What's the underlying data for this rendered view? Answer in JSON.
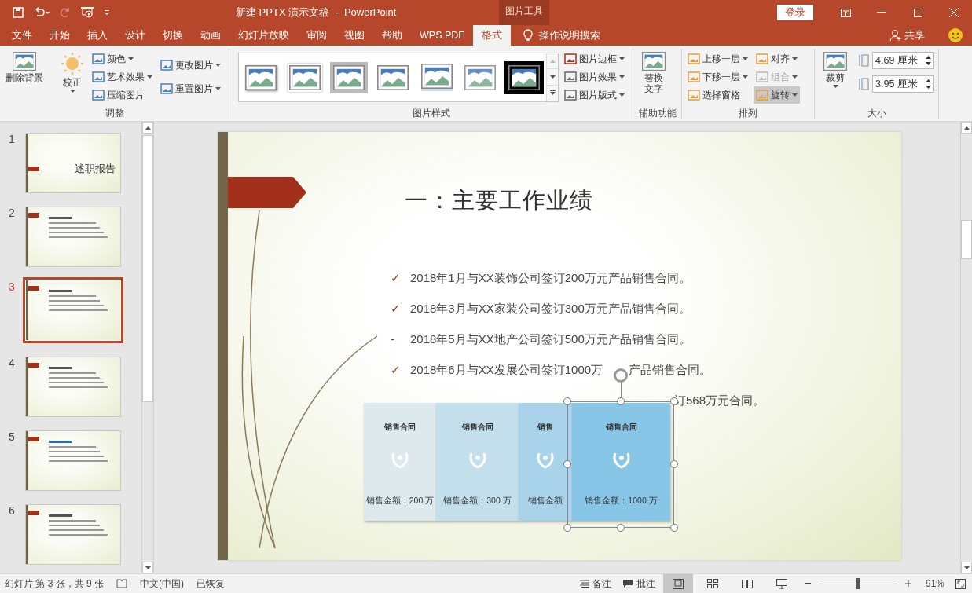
{
  "window": {
    "title": "新建 PPTX 演示文稿  -  PowerPoint",
    "context_tab": "图片工具",
    "login": "登录"
  },
  "tabs": [
    {
      "label": "文件",
      "selected": false
    },
    {
      "label": "开始",
      "selected": false
    },
    {
      "label": "插入",
      "selected": false
    },
    {
      "label": "设计",
      "selected": false
    },
    {
      "label": "切换",
      "selected": false
    },
    {
      "label": "动画",
      "selected": false
    },
    {
      "label": "幻灯片放映",
      "selected": false
    },
    {
      "label": "审阅",
      "selected": false
    },
    {
      "label": "视图",
      "selected": false
    },
    {
      "label": "帮助",
      "selected": false
    },
    {
      "label": "WPS PDF",
      "selected": false
    },
    {
      "label": "格式",
      "selected": true
    }
  ],
  "tell_me": "操作说明搜索",
  "share": "共享",
  "ribbon": {
    "adjust": {
      "label": "调整",
      "remove_bg": "删除背景",
      "corrections": "校正",
      "small": [
        {
          "label": "颜色",
          "caret": true
        },
        {
          "label": "艺术效果",
          "caret": true
        },
        {
          "label": "压缩图片",
          "caret": false
        }
      ],
      "change": [
        {
          "label": "更改图片"
        },
        {
          "label": "重置图片"
        }
      ]
    },
    "styles": {
      "label": "图片样式",
      "gallery": [
        {
          "kind": "shadow"
        },
        {
          "kind": "frame"
        },
        {
          "kind": "gray"
        },
        {
          "kind": "plain"
        },
        {
          "kind": "reflect"
        },
        {
          "kind": "soft"
        },
        {
          "kind": "black"
        }
      ],
      "buttons": [
        {
          "label": "图片边框"
        },
        {
          "label": "图片效果"
        },
        {
          "label": "图片版式"
        }
      ]
    },
    "accessibility": {
      "label": "辅助功能",
      "alt_text": "替换文字"
    },
    "arrange": {
      "label": "排列",
      "items": [
        {
          "label": "上移一层",
          "disabled": false,
          "pressed": false
        },
        {
          "label": "下移一层",
          "disabled": false,
          "pressed": false
        },
        {
          "label": "选择窗格",
          "disabled": false,
          "pressed": false
        }
      ],
      "items2": [
        {
          "label": "对齐",
          "disabled": false,
          "pressed": false
        },
        {
          "label": "组合",
          "disabled": true,
          "pressed": false
        },
        {
          "label": "旋转",
          "disabled": false,
          "pressed": true
        }
      ]
    },
    "size": {
      "label": "大小",
      "crop": "裁剪",
      "height": "4.69 厘米",
      "width": "3.95 厘米"
    }
  },
  "slides": [
    {
      "number": "1",
      "selected": false,
      "title": "述职报告"
    },
    {
      "number": "2",
      "selected": false
    },
    {
      "number": "3",
      "selected": true
    },
    {
      "number": "4",
      "selected": false
    },
    {
      "number": "5",
      "selected": false
    },
    {
      "number": "6",
      "selected": false
    }
  ],
  "slide": {
    "title": "一：主要工作业绩",
    "bullets": [
      {
        "kind": "full",
        "marker": "✓",
        "parts": [
          "2018年1月与XX装饰公司签订200万元产品销售合同。"
        ]
      },
      {
        "kind": "full",
        "marker": "✓",
        "parts": [
          "2018年3月与XX家装公司签订300万元产品销售合同。"
        ]
      },
      {
        "kind": "full",
        "marker": "-",
        "parts": [
          "2018年5月与XX地产公司签订500万元产品销售合同。"
        ]
      },
      {
        "kind": "full",
        "marker": "✓",
        "parts": [
          "2018年6月与XX发展公司签订1000万",
          "产品销售合同。"
        ]
      },
      {
        "kind": "covered",
        "parts": [
          "订568万元合同。"
        ]
      }
    ],
    "cards": [
      {
        "title": "销售合同",
        "amount": "销售金额：200 万",
        "color": "#dde9ed",
        "selected": false
      },
      {
        "title": "销售合同",
        "amount": "销售金额：300 万",
        "color": "#c2dfeb",
        "selected": false
      },
      {
        "title": "销售",
        "amount": "销售金额",
        "color": "#a9d3ea",
        "selected": false
      },
      {
        "title": "销售合同",
        "amount": "销售金额：1000 万",
        "color": "#88c6e8",
        "selected": true
      }
    ]
  },
  "status_bar": {
    "slide_info": "幻灯片 第 3 张，共 9 张",
    "language": "中文(中国)",
    "recovered": "已恢复",
    "notes": "备注",
    "comments": "批注",
    "zoom": {
      "text": "91%",
      "level": 0.5
    }
  }
}
